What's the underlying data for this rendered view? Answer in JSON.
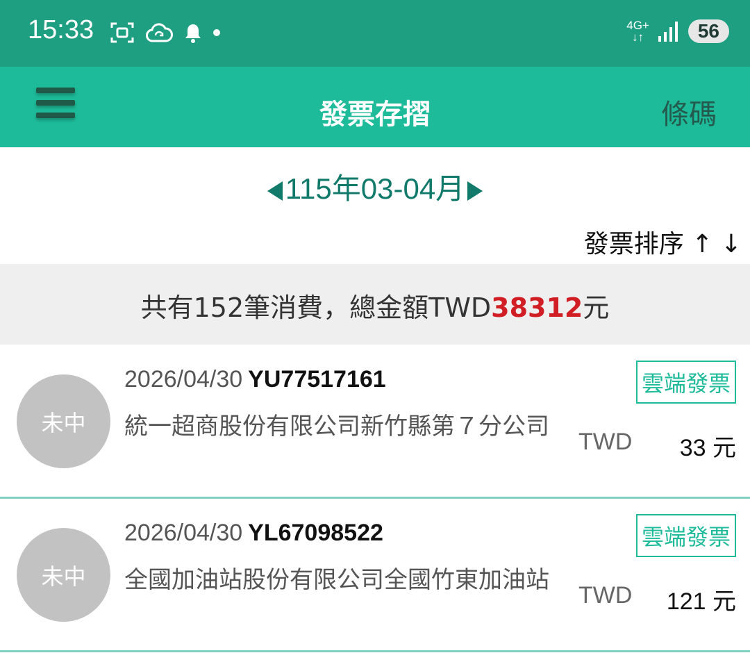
{
  "status_bar": {
    "time": "15:33",
    "network": "4G+",
    "battery": "56"
  },
  "header": {
    "title": "發票存摺",
    "barcode_label": "條碼"
  },
  "period": {
    "label": "115年03-04月"
  },
  "sort": {
    "label": "發票排序 ↑ ↓"
  },
  "summary": {
    "prefix": "共有152筆消費，總金額TWD",
    "amount": "38312",
    "suffix": "元"
  },
  "invoices": [
    {
      "status": "未中",
      "date": "2026/04/30",
      "number": "YU77517161",
      "type": "雲端發票",
      "store": "統一超商股份有限公司新竹縣第７分公司",
      "currency": "TWD",
      "amount": "33 元"
    },
    {
      "status": "未中",
      "date": "2026/04/30",
      "number": "YL67098522",
      "type": "雲端發票",
      "store": "全國加油站股份有限公司全國竹東加油站",
      "currency": "TWD",
      "amount": "121 元"
    }
  ],
  "colors": {
    "status_bar": "#1f9f82",
    "app_bar": "#1dbb99",
    "accent": "#127a6a",
    "amount_highlight": "#d11d24"
  }
}
